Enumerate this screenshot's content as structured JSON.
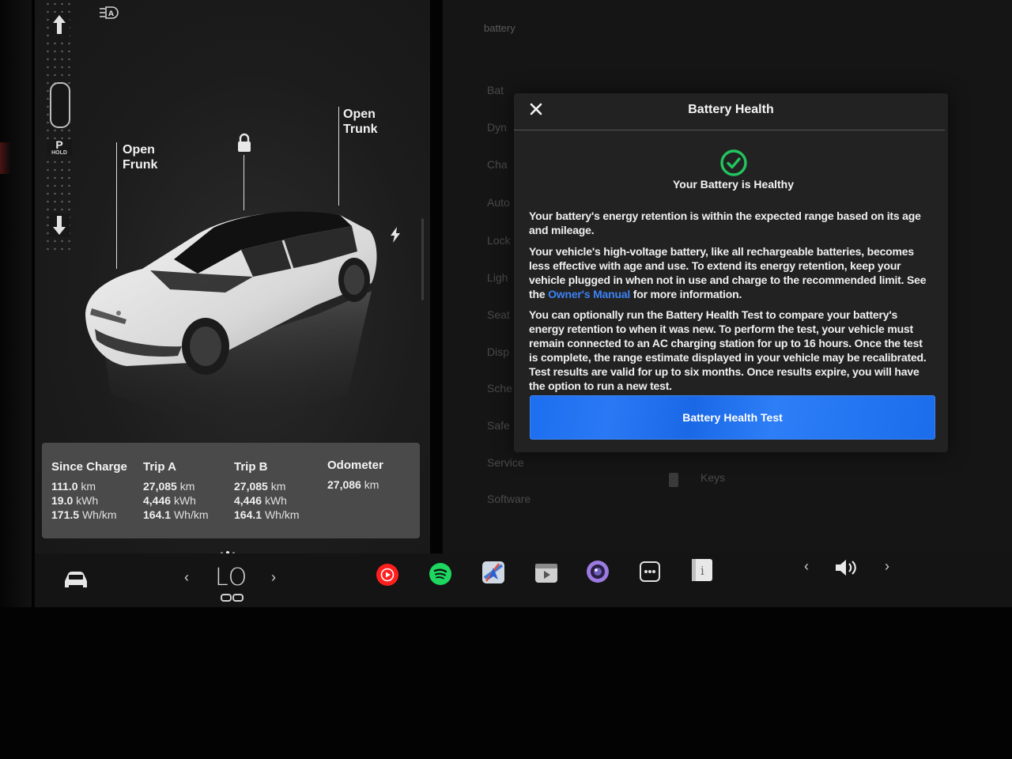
{
  "top_bar": {
    "auto_lights_icon": "auto-headlights-icon"
  },
  "gear_selector": {
    "up_icon": "arrow-up-icon",
    "down_icon": "arrow-down-icon",
    "park": "P",
    "hold": "HOLD"
  },
  "car_view": {
    "frunk_label": "Open\nFrunk",
    "trunk_label": "Open\nTrunk",
    "lock_icon": "lock-icon",
    "charge_icon": "lightning-icon"
  },
  "trip_stats": [
    {
      "title": "Since Charge",
      "lines": [
        {
          "v": "111.0",
          "u": "km"
        },
        {
          "v": "19.0",
          "u": "kWh"
        },
        {
          "v": "171.5",
          "u": "Wh/km"
        }
      ]
    },
    {
      "title": "Trip A",
      "lines": [
        {
          "v": "27,085",
          "u": "km"
        },
        {
          "v": "4,446",
          "u": "kWh"
        },
        {
          "v": "164.1",
          "u": "Wh/km"
        }
      ]
    },
    {
      "title": "Trip B",
      "lines": [
        {
          "v": "27,085",
          "u": "km"
        },
        {
          "v": "4,446",
          "u": "kWh"
        },
        {
          "v": "164.1",
          "u": "Wh/km"
        }
      ]
    },
    {
      "title": "Odometer",
      "lines": [
        {
          "v": "27,086",
          "u": "km"
        }
      ]
    }
  ],
  "settings_bg": {
    "search": "battery",
    "items": [
      "Bat",
      "Dyn",
      "Cha",
      "Auto",
      "Lock",
      "Ligh",
      "Seat",
      "Disp",
      "Sche",
      "Safe",
      "Service",
      "Software"
    ],
    "keys_title": "Keys"
  },
  "modal": {
    "title": "Battery Health",
    "status": "Your Battery is Healthy",
    "para1": "Your battery's energy retention is within the expected range based on its age and mileage.",
    "para2_before": "Your vehicle's high-voltage battery, like all rechargeable batteries, becomes less effective with age and use. To extend its energy retention, keep your vehicle plugged in when not in use and charge to the recommended limit. See the ",
    "para2_link": "Owner's Manual",
    "para2_after": " for more information.",
    "para3": "You can optionally run the Battery Health Test to compare your battery's energy retention to when it was new. To perform the test, your vehicle must remain connected to an AC charging station for up to 16 hours. Once the test is complete, the range estimate displayed in your vehicle may be recalibrated. Test results are valid for up to six months. Once results expire, you will have the option to run a new test.",
    "button": "Battery Health Test"
  },
  "taskbar": {
    "climate": "LO",
    "apps": [
      "youtube-music-icon",
      "spotify-icon",
      "navigation-icon",
      "theater-icon",
      "camera-icon",
      "more-apps-icon",
      "manual-icon"
    ],
    "volume_icon": "volume-icon"
  },
  "colors": {
    "accent_blue": "#1d6ff0",
    "check_green": "#22c55e",
    "link_blue": "#3b82f6"
  }
}
